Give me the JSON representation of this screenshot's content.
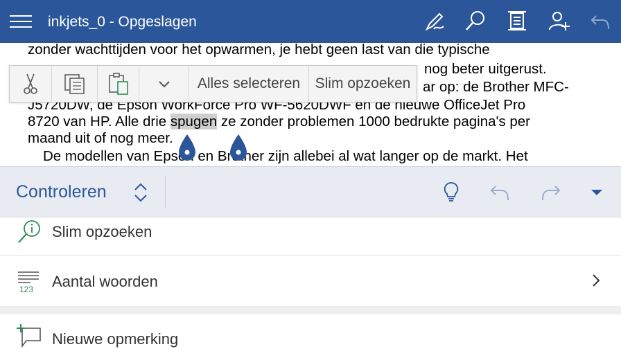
{
  "app": {
    "title": "inkjets_0 - Opgeslagen",
    "accent": "#2b579a"
  },
  "toolbar_icons": [
    "pen-draw-icon",
    "search-icon",
    "layout-view-icon",
    "share-person-icon",
    "undo-icon"
  ],
  "document": {
    "lines": [
      "zonder wachttijden voor het opwarmen, je hebt geen last van die typische",
      "nog beter uitgerust.",
      "ar op: de Brother MFC-",
      "J5720DW, de Epson WorkForce Pro WF-5620DWF en de nieuwe OfficeJet Pro",
      "8720 van HP. Alle drie ",
      "spugen",
      " ze zonder problemen 1000 bedrukte pagina's per",
      "maand uit of nog meer.",
      "De modellen van Epson en Brother zijn allebei al wat langer op de markt. Het"
    ]
  },
  "context_menu": {
    "icons": [
      "cut-icon",
      "copy-icon",
      "paste-icon",
      "chevron-down-icon"
    ],
    "select_all": "Alles selecteren",
    "smart_lookup": "Slim opzoeken"
  },
  "ribbon": {
    "label": "Controleren",
    "icons": [
      "tell-me-lightbulb-icon",
      "undo-icon",
      "redo-icon",
      "collapse-caret-icon"
    ]
  },
  "list": {
    "items": [
      {
        "label": "Slim opzoeken",
        "icon": "smart-lookup-icon"
      },
      {
        "label": "Aantal woorden",
        "icon": "word-count-icon"
      },
      {
        "label": "Nieuwe opmerking",
        "icon": "new-comment-icon"
      }
    ]
  }
}
